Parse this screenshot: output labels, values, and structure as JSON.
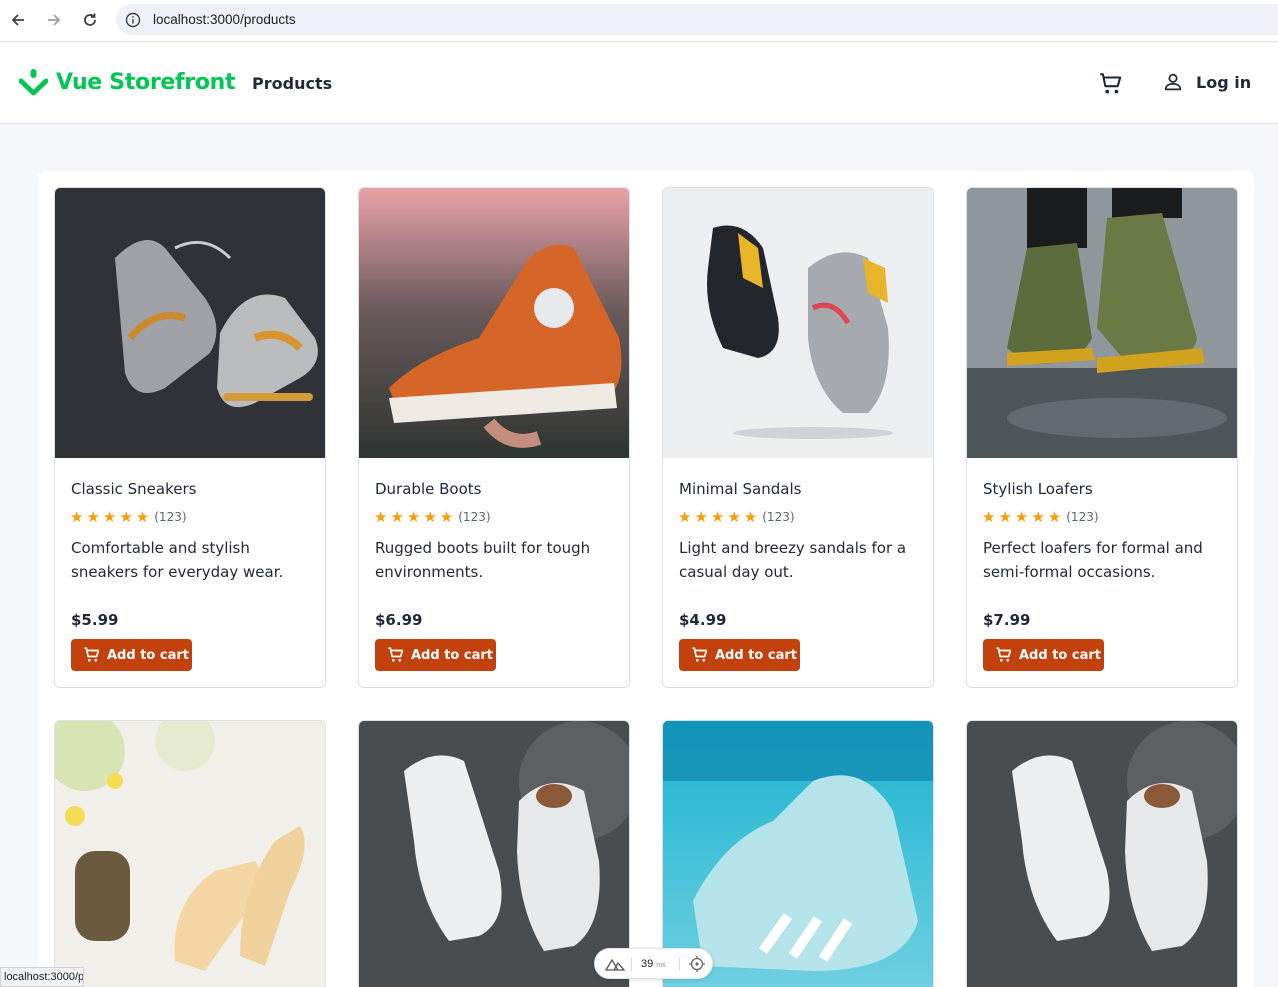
{
  "browser": {
    "url": "localhost:3000/products",
    "status_url": "localhost:3000/p"
  },
  "header": {
    "brand": "Vue Storefront",
    "nav_products": "Products",
    "login_label": "Log in"
  },
  "colors": {
    "brand_green": "#02c652",
    "button_orange": "#c2410c",
    "star": "#f59e0b"
  },
  "products": [
    {
      "title": "Classic Sneakers",
      "rating_count": "(123)",
      "rating": 5,
      "description": "Comfortable and stylish sneakers for everyday wear.",
      "price": "$5.99",
      "button": "Add to cart"
    },
    {
      "title": "Durable Boots",
      "rating_count": "(123)",
      "rating": 5,
      "description": "Rugged boots built for tough environments.",
      "price": "$6.99",
      "button": "Add to cart"
    },
    {
      "title": "Minimal Sandals",
      "rating_count": "(123)",
      "rating": 5,
      "description": "Light and breezy sandals for a casual day out.",
      "price": "$4.99",
      "button": "Add to cart"
    },
    {
      "title": "Stylish Loafers",
      "rating_count": "(123)",
      "rating": 5,
      "description": "Perfect loafers for formal and semi-formal occasions.",
      "price": "$7.99",
      "button": "Add to cart"
    }
  ],
  "devtools": {
    "ms_value": "39",
    "ms_unit": "ms"
  }
}
